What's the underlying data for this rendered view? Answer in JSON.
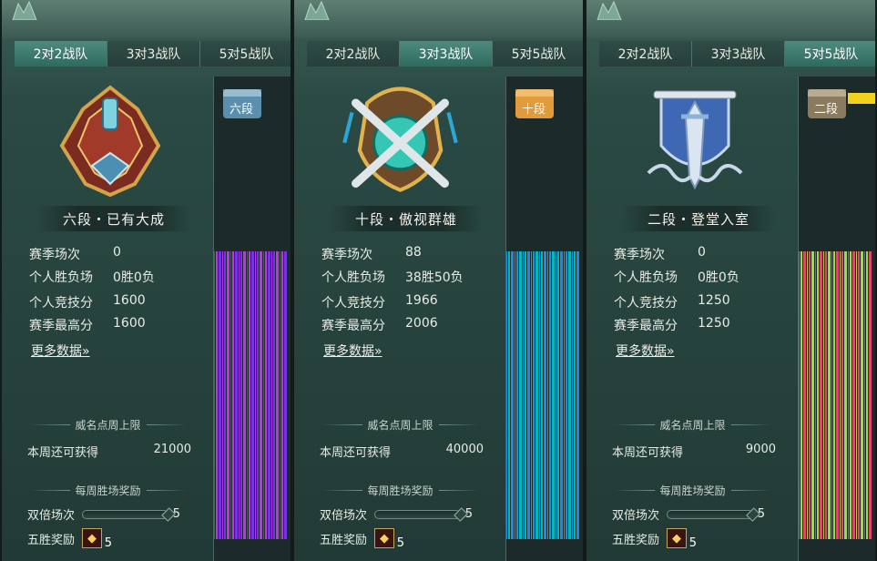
{
  "tabs": [
    "2对2战队",
    "3对3战队",
    "5对5战队"
  ],
  "labels": {
    "season_matches": "赛季场次",
    "win_loss": "个人胜负场",
    "personal_rating": "个人竞技分",
    "season_best": "赛季最高分",
    "more_data": "更多数据»",
    "weekly_cap_header": "威名点周上限",
    "weekly_remaining": "本周还可获得",
    "weekly_win_reward_header": "每周胜场奖励",
    "double_matches": "双倍场次",
    "five_win_reward": "五胜奖励"
  },
  "panels": [
    {
      "active_tab": 0,
      "rank_title": "六段・已有大成",
      "chest_label": "六段",
      "chest_color": "#5b8fb0",
      "bar_fill_color": "",
      "season_matches": "0",
      "win_loss": "0胜0负",
      "personal_rating": "1600",
      "season_best": "1600",
      "weekly_remaining_value": "21000",
      "double_count": "5",
      "five_win_count": "5",
      "badge_icon": "red-gold-crest-icon"
    },
    {
      "active_tab": 1,
      "rank_title": "十段・傲视群雄",
      "chest_label": "十段",
      "chest_color": "#e19a3c",
      "bar_fill_color": "",
      "season_matches": "88",
      "win_loss": "38胜50负",
      "personal_rating": "1966",
      "season_best": "2006",
      "weekly_remaining_value": "40000",
      "double_count": "5",
      "five_win_count": "5",
      "badge_icon": "crossed-swords-shield-icon"
    },
    {
      "active_tab": 2,
      "rank_title": "二段・登堂入室",
      "chest_label": "二段",
      "chest_color": "#8a7a60",
      "bar_fill_color": "#f2d21a",
      "season_matches": "0",
      "win_loss": "0胜0负",
      "personal_rating": "1250",
      "season_best": "1250",
      "weekly_remaining_value": "9000",
      "double_count": "5",
      "five_win_count": "5",
      "badge_icon": "banner-sword-icon"
    }
  ]
}
